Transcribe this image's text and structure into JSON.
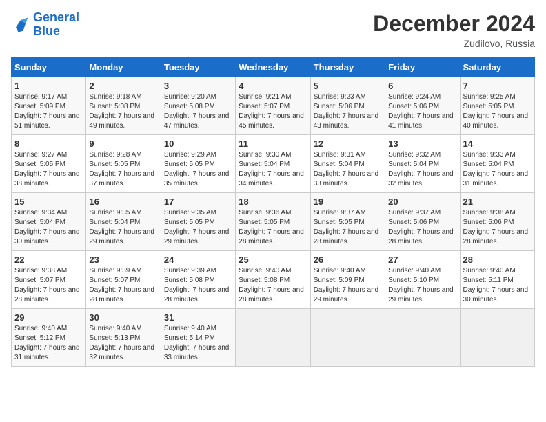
{
  "logo": {
    "text_general": "General",
    "text_blue": "Blue"
  },
  "header": {
    "month": "December 2024",
    "location": "Zudilovo, Russia"
  },
  "weekdays": [
    "Sunday",
    "Monday",
    "Tuesday",
    "Wednesday",
    "Thursday",
    "Friday",
    "Saturday"
  ],
  "weeks": [
    [
      {
        "day": "1",
        "sunrise": "Sunrise: 9:17 AM",
        "sunset": "Sunset: 5:09 PM",
        "daylight": "Daylight: 7 hours and 51 minutes."
      },
      {
        "day": "2",
        "sunrise": "Sunrise: 9:18 AM",
        "sunset": "Sunset: 5:08 PM",
        "daylight": "Daylight: 7 hours and 49 minutes."
      },
      {
        "day": "3",
        "sunrise": "Sunrise: 9:20 AM",
        "sunset": "Sunset: 5:08 PM",
        "daylight": "Daylight: 7 hours and 47 minutes."
      },
      {
        "day": "4",
        "sunrise": "Sunrise: 9:21 AM",
        "sunset": "Sunset: 5:07 PM",
        "daylight": "Daylight: 7 hours and 45 minutes."
      },
      {
        "day": "5",
        "sunrise": "Sunrise: 9:23 AM",
        "sunset": "Sunset: 5:06 PM",
        "daylight": "Daylight: 7 hours and 43 minutes."
      },
      {
        "day": "6",
        "sunrise": "Sunrise: 9:24 AM",
        "sunset": "Sunset: 5:06 PM",
        "daylight": "Daylight: 7 hours and 41 minutes."
      },
      {
        "day": "7",
        "sunrise": "Sunrise: 9:25 AM",
        "sunset": "Sunset: 5:05 PM",
        "daylight": "Daylight: 7 hours and 40 minutes."
      }
    ],
    [
      {
        "day": "8",
        "sunrise": "Sunrise: 9:27 AM",
        "sunset": "Sunset: 5:05 PM",
        "daylight": "Daylight: 7 hours and 38 minutes."
      },
      {
        "day": "9",
        "sunrise": "Sunrise: 9:28 AM",
        "sunset": "Sunset: 5:05 PM",
        "daylight": "Daylight: 7 hours and 37 minutes."
      },
      {
        "day": "10",
        "sunrise": "Sunrise: 9:29 AM",
        "sunset": "Sunset: 5:05 PM",
        "daylight": "Daylight: 7 hours and 35 minutes."
      },
      {
        "day": "11",
        "sunrise": "Sunrise: 9:30 AM",
        "sunset": "Sunset: 5:04 PM",
        "daylight": "Daylight: 7 hours and 34 minutes."
      },
      {
        "day": "12",
        "sunrise": "Sunrise: 9:31 AM",
        "sunset": "Sunset: 5:04 PM",
        "daylight": "Daylight: 7 hours and 33 minutes."
      },
      {
        "day": "13",
        "sunrise": "Sunrise: 9:32 AM",
        "sunset": "Sunset: 5:04 PM",
        "daylight": "Daylight: 7 hours and 32 minutes."
      },
      {
        "day": "14",
        "sunrise": "Sunrise: 9:33 AM",
        "sunset": "Sunset: 5:04 PM",
        "daylight": "Daylight: 7 hours and 31 minutes."
      }
    ],
    [
      {
        "day": "15",
        "sunrise": "Sunrise: 9:34 AM",
        "sunset": "Sunset: 5:04 PM",
        "daylight": "Daylight: 7 hours and 30 minutes."
      },
      {
        "day": "16",
        "sunrise": "Sunrise: 9:35 AM",
        "sunset": "Sunset: 5:04 PM",
        "daylight": "Daylight: 7 hours and 29 minutes."
      },
      {
        "day": "17",
        "sunrise": "Sunrise: 9:35 AM",
        "sunset": "Sunset: 5:05 PM",
        "daylight": "Daylight: 7 hours and 29 minutes."
      },
      {
        "day": "18",
        "sunrise": "Sunrise: 9:36 AM",
        "sunset": "Sunset: 5:05 PM",
        "daylight": "Daylight: 7 hours and 28 minutes."
      },
      {
        "day": "19",
        "sunrise": "Sunrise: 9:37 AM",
        "sunset": "Sunset: 5:05 PM",
        "daylight": "Daylight: 7 hours and 28 minutes."
      },
      {
        "day": "20",
        "sunrise": "Sunrise: 9:37 AM",
        "sunset": "Sunset: 5:06 PM",
        "daylight": "Daylight: 7 hours and 28 minutes."
      },
      {
        "day": "21",
        "sunrise": "Sunrise: 9:38 AM",
        "sunset": "Sunset: 5:06 PM",
        "daylight": "Daylight: 7 hours and 28 minutes."
      }
    ],
    [
      {
        "day": "22",
        "sunrise": "Sunrise: 9:38 AM",
        "sunset": "Sunset: 5:07 PM",
        "daylight": "Daylight: 7 hours and 28 minutes."
      },
      {
        "day": "23",
        "sunrise": "Sunrise: 9:39 AM",
        "sunset": "Sunset: 5:07 PM",
        "daylight": "Daylight: 7 hours and 28 minutes."
      },
      {
        "day": "24",
        "sunrise": "Sunrise: 9:39 AM",
        "sunset": "Sunset: 5:08 PM",
        "daylight": "Daylight: 7 hours and 28 minutes."
      },
      {
        "day": "25",
        "sunrise": "Sunrise: 9:40 AM",
        "sunset": "Sunset: 5:08 PM",
        "daylight": "Daylight: 7 hours and 28 minutes."
      },
      {
        "day": "26",
        "sunrise": "Sunrise: 9:40 AM",
        "sunset": "Sunset: 5:09 PM",
        "daylight": "Daylight: 7 hours and 29 minutes."
      },
      {
        "day": "27",
        "sunrise": "Sunrise: 9:40 AM",
        "sunset": "Sunset: 5:10 PM",
        "daylight": "Daylight: 7 hours and 29 minutes."
      },
      {
        "day": "28",
        "sunrise": "Sunrise: 9:40 AM",
        "sunset": "Sunset: 5:11 PM",
        "daylight": "Daylight: 7 hours and 30 minutes."
      }
    ],
    [
      {
        "day": "29",
        "sunrise": "Sunrise: 9:40 AM",
        "sunset": "Sunset: 5:12 PM",
        "daylight": "Daylight: 7 hours and 31 minutes."
      },
      {
        "day": "30",
        "sunrise": "Sunrise: 9:40 AM",
        "sunset": "Sunset: 5:13 PM",
        "daylight": "Daylight: 7 hours and 32 minutes."
      },
      {
        "day": "31",
        "sunrise": "Sunrise: 9:40 AM",
        "sunset": "Sunset: 5:14 PM",
        "daylight": "Daylight: 7 hours and 33 minutes."
      },
      null,
      null,
      null,
      null
    ]
  ]
}
